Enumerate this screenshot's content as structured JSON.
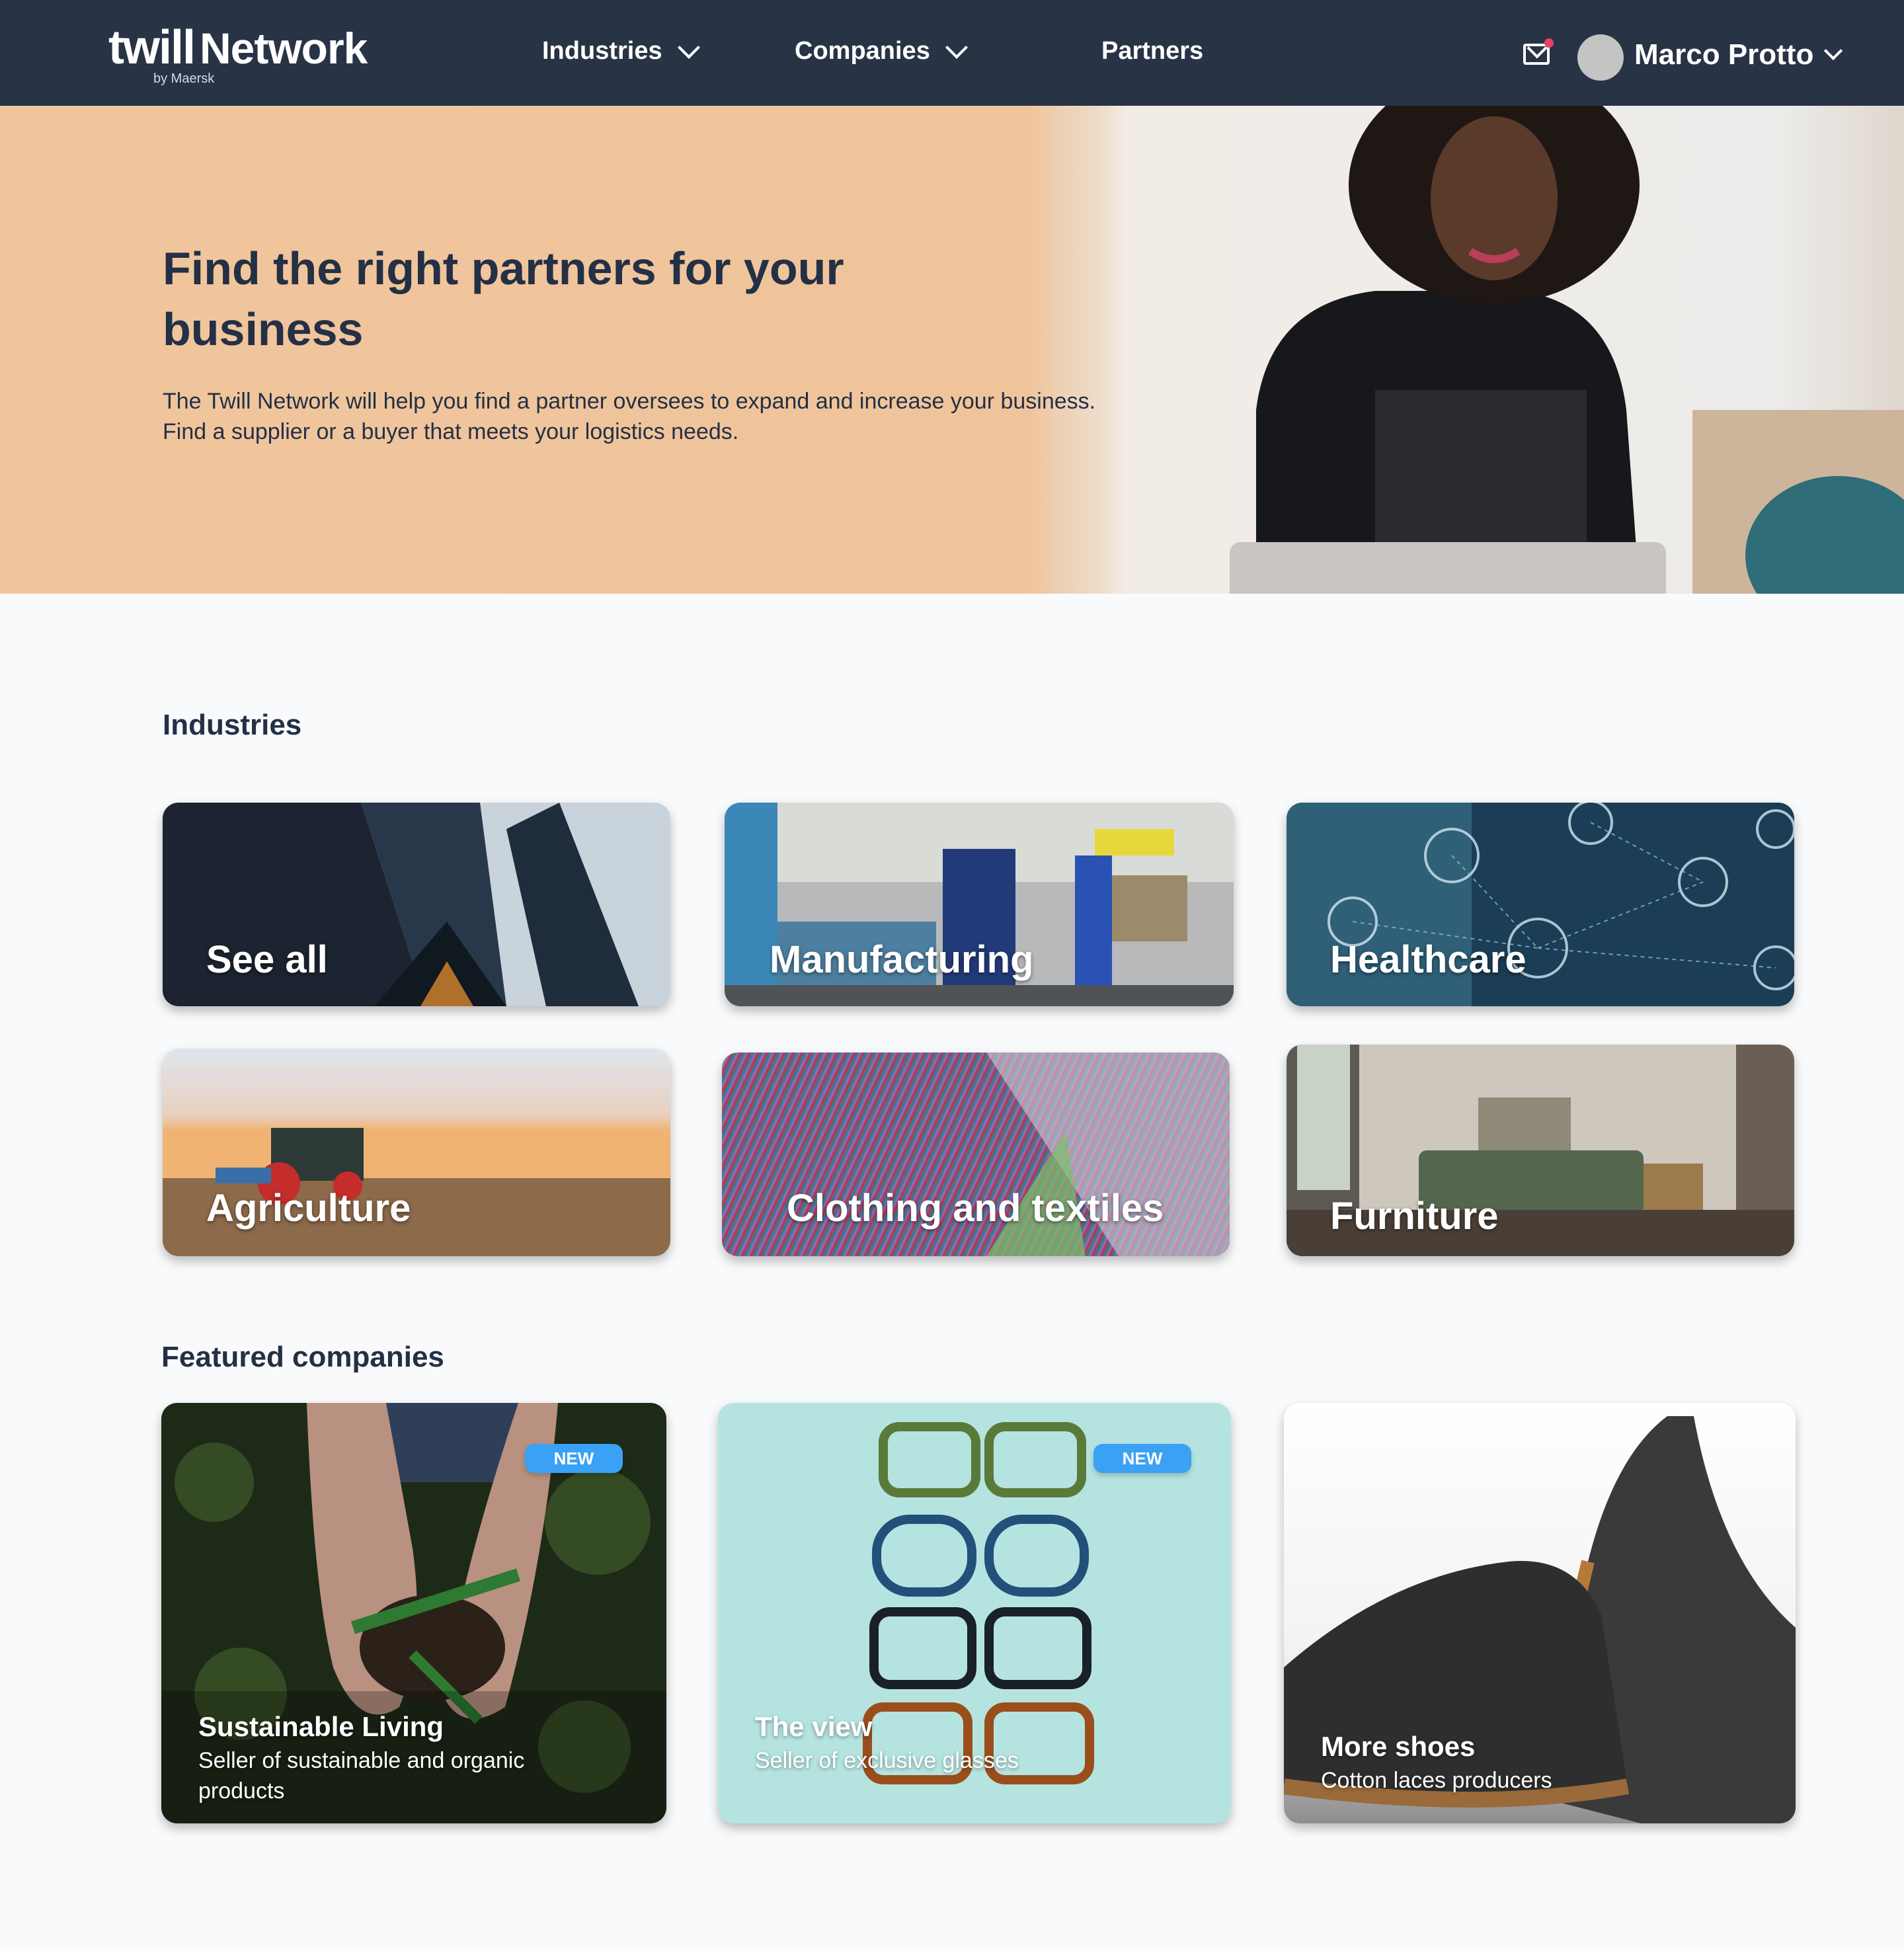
{
  "nav": {
    "logo_main": "twill",
    "logo_network": "Network",
    "logo_sub": "by Maersk",
    "links": [
      {
        "label": "Industries",
        "has_dropdown": true
      },
      {
        "label": "Companies",
        "has_dropdown": true
      },
      {
        "label": "Partners",
        "has_dropdown": false
      }
    ],
    "mail_icon": "mail-icon",
    "has_notification": true,
    "user_name": "Marco Protto"
  },
  "hero": {
    "title": "Find the right partners for your business",
    "text_line1": "The Twill Network will help you find a partner oversees to expand and increase your business.",
    "text_line2": "Find a supplier or a buyer that meets your logistics needs."
  },
  "industries": {
    "title": "Industries",
    "items": [
      {
        "label": "See all"
      },
      {
        "label": "Manufacturing"
      },
      {
        "label": "Healthcare"
      },
      {
        "label": "Agriculture"
      },
      {
        "label": "Clothing and textiles"
      },
      {
        "label": "Furniture"
      }
    ]
  },
  "featured": {
    "title": "Featured companies",
    "items": [
      {
        "name": "Sustainable Living",
        "description": "Seller of sustainable and organic products",
        "badge": "NEW"
      },
      {
        "name": "The view",
        "description": "Seller of exclusive glasses",
        "badge": "NEW"
      },
      {
        "name": "More shoes",
        "description": "Cotton laces producers",
        "badge": null
      }
    ]
  },
  "colors": {
    "nav_bg": "#283346",
    "text_dark": "#233045",
    "badge_blue": "#3aa1f5",
    "notification_red": "#e8425a",
    "page_bg": "#f9fafc"
  }
}
